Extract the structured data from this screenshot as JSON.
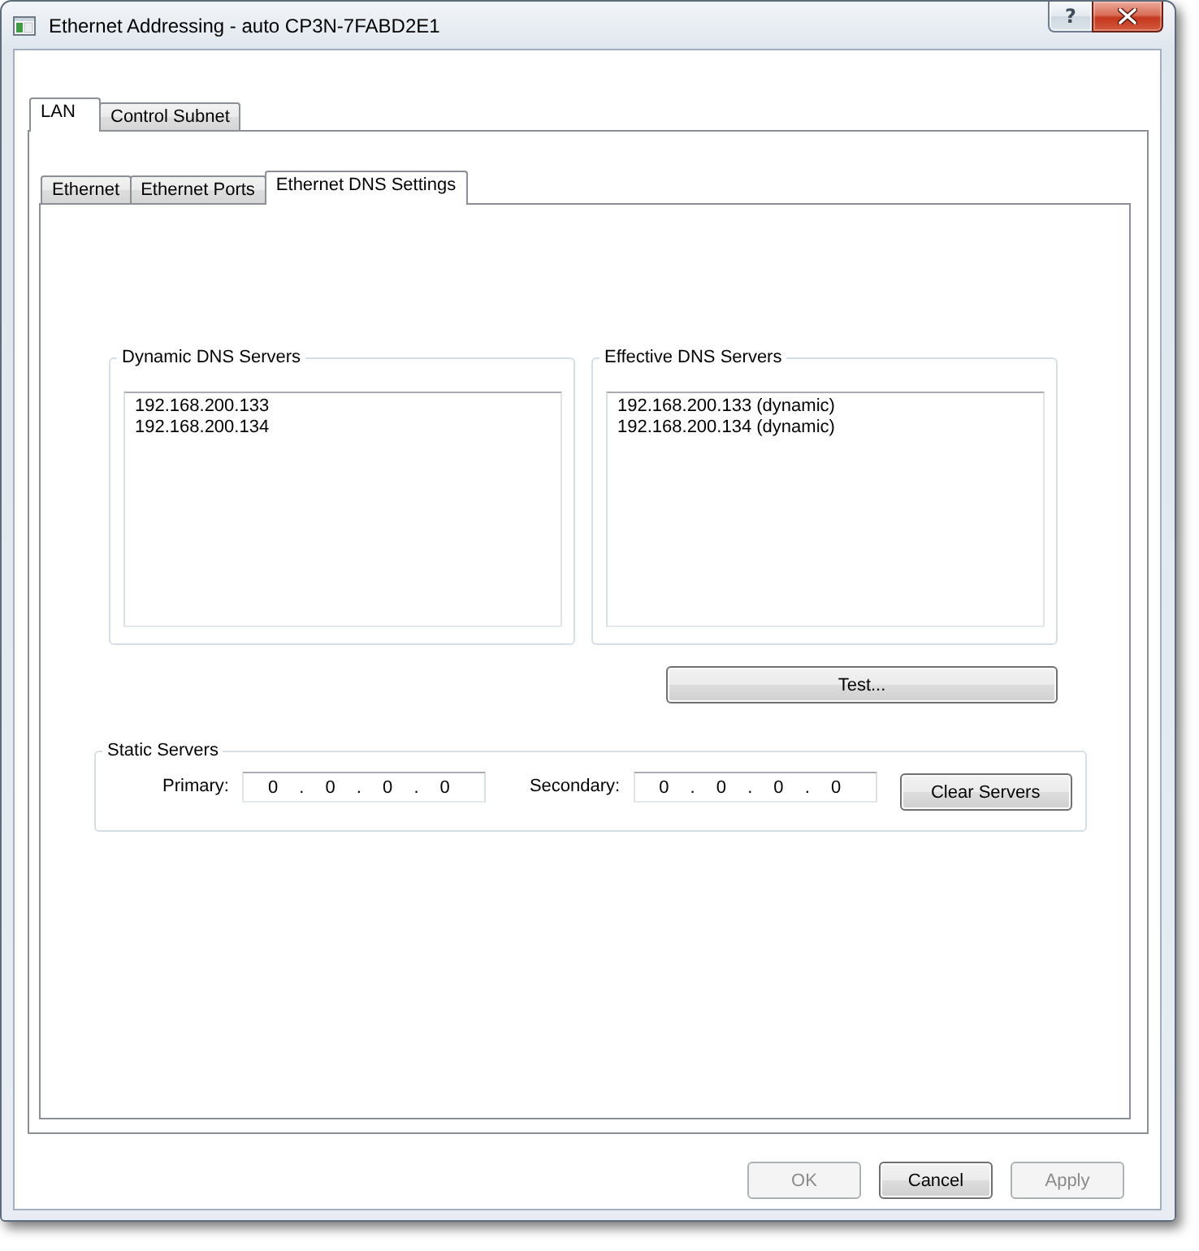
{
  "window": {
    "title": "Ethernet Addressing - auto CP3N-7FABD2E1",
    "caption_buttons": [
      {
        "kind": "help",
        "label": "?"
      },
      {
        "kind": "close"
      }
    ]
  },
  "tabs": [
    {
      "label": "LAN",
      "selected": true
    },
    {
      "label": "Control Subnet",
      "selected": false
    }
  ],
  "subtabs": [
    {
      "label": "Ethernet",
      "selected": false
    },
    {
      "label": "Ethernet Ports",
      "selected": false
    },
    {
      "label": "Ethernet DNS Settings",
      "selected": true
    }
  ],
  "dns_groups": [
    {
      "title": "Dynamic DNS Servers",
      "items": [
        "192.168.200.133",
        "192.168.200.134"
      ]
    },
    {
      "title": "Effective DNS Servers",
      "items": [
        "192.168.200.133 (dynamic)",
        "192.168.200.134 (dynamic)"
      ]
    }
  ],
  "test_button": {
    "label": "Test..."
  },
  "static_servers": {
    "title": "Static Servers",
    "fields": [
      {
        "label": "Primary:",
        "value": "0 . 0 . 0 . 0"
      },
      {
        "label": "Secondary:",
        "value": "0 . 0 . 0 . 0"
      }
    ],
    "clear_button": {
      "label": "Clear Servers"
    }
  },
  "buttons": [
    {
      "label": "OK",
      "disabled": true
    },
    {
      "label": "Cancel",
      "disabled": false
    },
    {
      "label": "Apply",
      "disabled": true
    }
  ]
}
